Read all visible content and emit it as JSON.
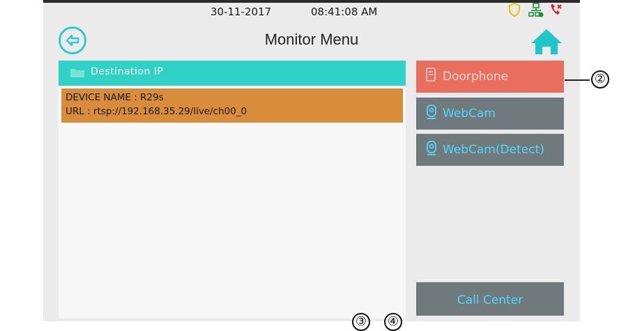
{
  "status_bar": {
    "date": "30-11-2017",
    "time": "08:41:08  AM",
    "icons": [
      "shield-icon",
      "network-icon",
      "missed-call-icon"
    ]
  },
  "header": {
    "title": "Monitor Menu",
    "back_icon": "back-arrow-icon",
    "home_icon": "home-icon"
  },
  "list": {
    "header_label": "Destination IP",
    "items": [
      {
        "device_name": "DEVICE NAME : R29s",
        "url": "URL : rtsp://192.168.35.29/live/ch00_0"
      }
    ]
  },
  "side_menu": {
    "doorphone": "Doorphone",
    "webcam": "WebCam",
    "webcam_detect": "WebCam(Detect)",
    "call_center": "Call Center"
  },
  "callouts": {
    "c2": "②",
    "c3": "③",
    "c4": "④"
  },
  "colors": {
    "accent_teal": "#30d2c8",
    "doorphone_red": "#ea6e5e",
    "device_orange": "#d98c3a",
    "button_gray": "#707a7c",
    "button_text_cyan": "#4fd8ff"
  }
}
